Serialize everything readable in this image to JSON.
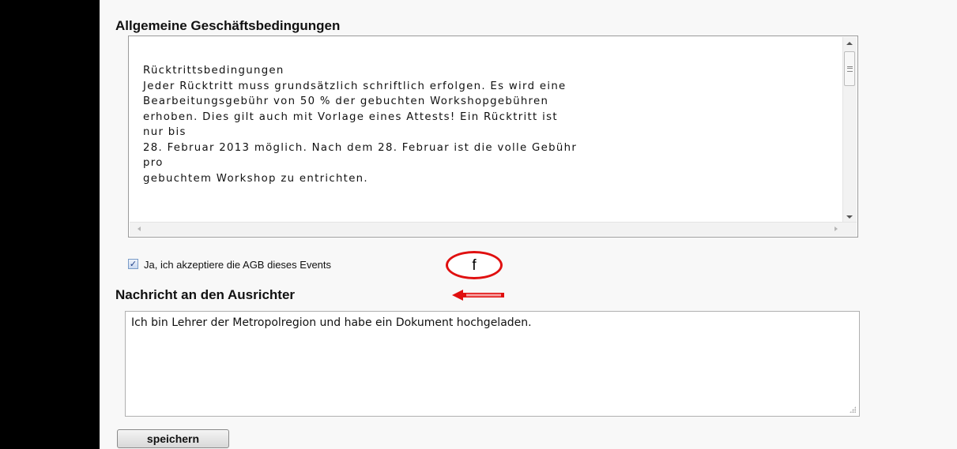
{
  "agb": {
    "heading": "Allgemeine Geschäftsbedingungen",
    "terms_text": "Rücktrittsbedingungen\nJeder Rücktritt muss grundsätzlich schriftlich erfolgen. Es wird eine\nBearbeitungsgebühr von 50 % der gebuchten Workshopgebühren\nerhoben. Dies gilt auch mit Vorlage eines Attests! Ein Rücktritt ist\nnur bis\n28. Februar 2013 möglich. Nach dem 28. Februar ist die volle Gebühr\npro\ngebuchtem Workshop zu entrichten.",
    "accept_label": "Ja, ich akzeptiere die AGB dieses Events",
    "accept_checked": true,
    "checkmark": "✓"
  },
  "annotations": {
    "circle_letter": "f",
    "color": "#e01010"
  },
  "message": {
    "heading": "Nachricht an den Ausrichter",
    "text": "Ich bin Lehrer der Metropolregion und habe ein Dokument hochgeladen."
  },
  "actions": {
    "save_label": "speichern"
  }
}
